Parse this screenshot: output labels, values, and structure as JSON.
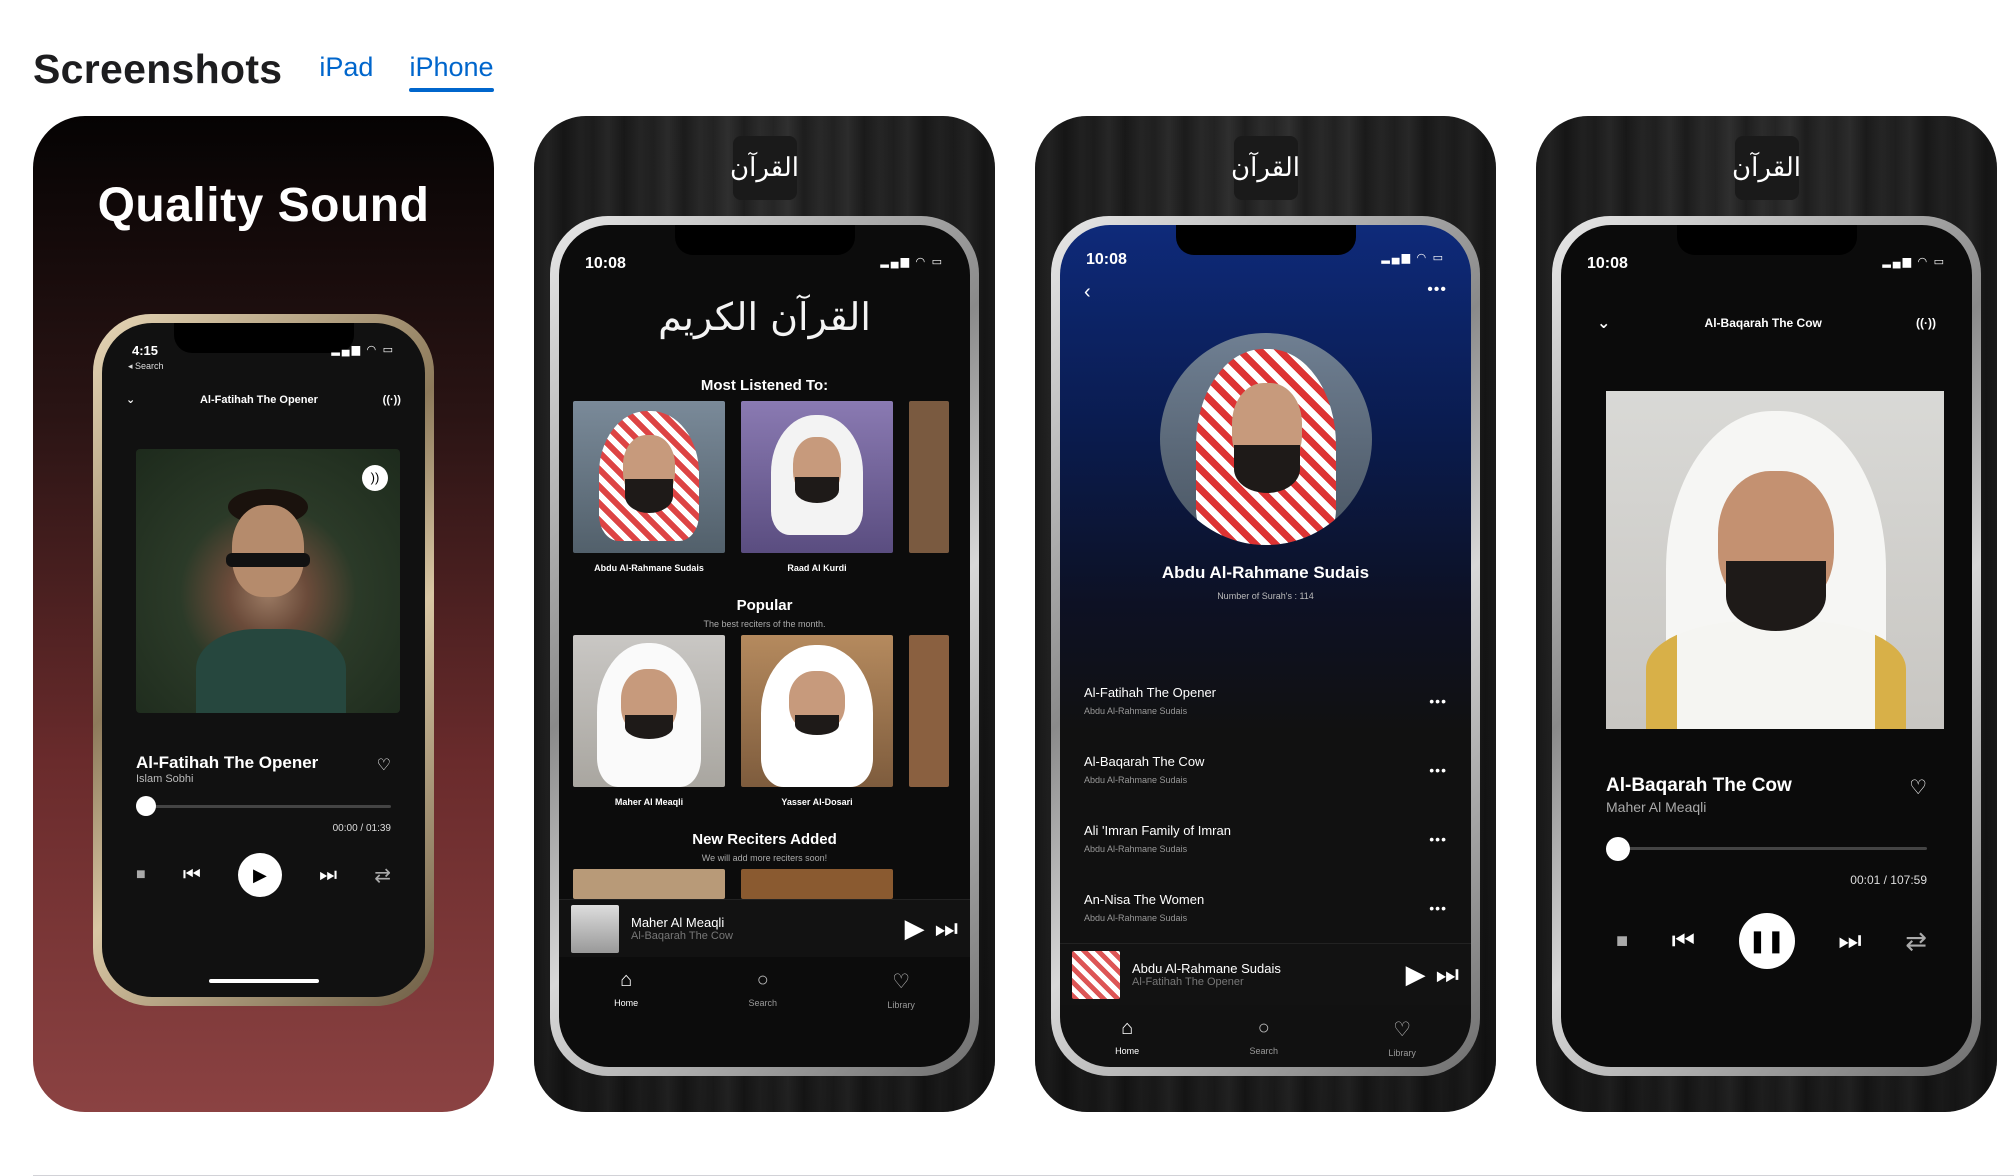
{
  "header": {
    "title": "Screenshots",
    "tabs": [
      {
        "label": "iPad",
        "active": false
      },
      {
        "label": "iPhone",
        "active": true
      }
    ]
  },
  "card1": {
    "headline": "Quality Sound",
    "phone": {
      "time": "4:15",
      "back_label": "◂ Search",
      "now_playing": "Al-Fatihah The Opener",
      "song_title": "Al-Fatihah The Opener",
      "artist": "Islam Sobhi",
      "time_display": "00:00 / 01:39",
      "progress": 0.0
    }
  },
  "card2": {
    "logo_text": "القرآن",
    "phone": {
      "time": "10:08",
      "calligraphy": "القرآن الكريم",
      "most_listened_title": "Most Listened To:",
      "most_listened": [
        "Abdu Al-Rahmane Sudais",
        "Raad Al Kurdi"
      ],
      "popular_title": "Popular",
      "popular_subtitle": "The best reciters of the month.",
      "popular": [
        "Maher Al Meaqli",
        "Yasser Al-Dosari"
      ],
      "new_title": "New Reciters Added",
      "new_subtitle": "We will add more reciters soon!",
      "mini_player": {
        "reciter": "Maher Al Meaqli",
        "surah": "Al-Baqarah The Cow"
      },
      "tabs": [
        "Home",
        "Search",
        "Library"
      ]
    }
  },
  "card3": {
    "logo_text": "القرآن",
    "phone": {
      "time": "10:08",
      "reciter_name": "Abdu Al-Rahmane Sudais",
      "surah_count": "Number of Surah's : 114",
      "tracks": [
        {
          "title": "Al-Fatihah The Opener",
          "reciter": "Abdu Al-Rahmane Sudais"
        },
        {
          "title": "Al-Baqarah The Cow",
          "reciter": "Abdu Al-Rahmane Sudais"
        },
        {
          "title": "Ali 'Imran Family of Imran",
          "reciter": "Abdu Al-Rahmane Sudais"
        },
        {
          "title": "An-Nisa The Women",
          "reciter": "Abdu Al-Rahmane Sudais"
        }
      ],
      "mini_player": {
        "reciter": "Abdu Al-Rahmane Sudais",
        "surah": "Al-Fatihah The Opener"
      },
      "tabs": [
        "Home",
        "Search",
        "Library"
      ]
    }
  },
  "card4": {
    "logo_text": "القرآن",
    "phone": {
      "time": "10:08",
      "now_playing": "Al-Baqarah The Cow",
      "song_title": "Al-Baqarah The Cow",
      "artist": "Maher Al Meaqli",
      "time_display": "00:01 / 107:59",
      "progress": 0.0
    }
  },
  "colors": {
    "link": "#0066cc",
    "card1_gradient_end": "#8b4242",
    "blue_header": "#0e2a7a"
  }
}
